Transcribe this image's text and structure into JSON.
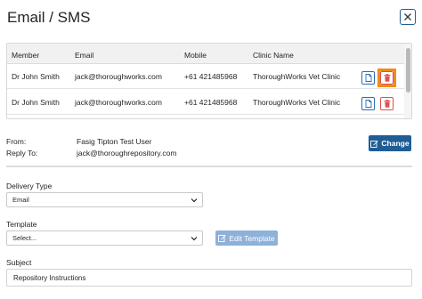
{
  "dialog": {
    "title": "Email / SMS"
  },
  "recipients": {
    "columns": [
      "Member",
      "Email",
      "Mobile",
      "Clinic Name"
    ],
    "rows": [
      {
        "member": "Dr John Smith",
        "email": "jack@thoroughworks.com",
        "mobile": "+61 421485968",
        "clinic": "ThoroughWorks Vet Clinic"
      },
      {
        "member": "Dr John Smith",
        "email": "jack@thoroughworks.com",
        "mobile": "+61 421485968",
        "clinic": "ThoroughWorks Vet Clinic"
      }
    ]
  },
  "sender": {
    "from_label": "From:",
    "from_value": "Fasig Tipton Test User",
    "reply_label": "Reply To:",
    "reply_value": "jack@thoroughrepository.com",
    "change_label": "Change"
  },
  "delivery": {
    "label": "Delivery Type",
    "value": "Email"
  },
  "template": {
    "label": "Template",
    "value": "Select...",
    "edit_label": "Edit Template"
  },
  "subject": {
    "label": "Subject",
    "value": "Repository Instructions"
  },
  "colors": {
    "primary": "#1f5d94",
    "danger": "#d9534f",
    "highlight": "#f08a1c",
    "disabled_primary": "#8fb1d9"
  },
  "icons": [
    "close-icon",
    "document-icon",
    "trash-icon",
    "edit-icon",
    "chevron-down-icon"
  ]
}
